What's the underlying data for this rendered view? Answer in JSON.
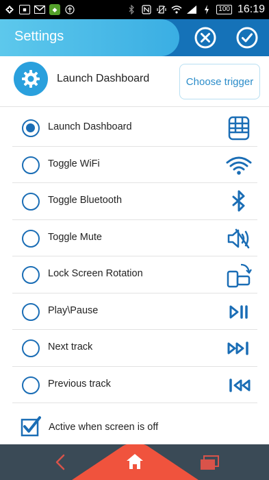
{
  "status_bar": {
    "time": "16:19",
    "battery": "100"
  },
  "header": {
    "title": "Settings"
  },
  "trigger": {
    "label": "Launch Dashboard",
    "button_label": "Choose trigger"
  },
  "options": [
    {
      "label": "Launch Dashboard",
      "checked": true,
      "icon": "dashboard-grid-icon"
    },
    {
      "label": "Toggle WiFi",
      "checked": false,
      "icon": "wifi-icon"
    },
    {
      "label": "Toggle Bluetooth",
      "checked": false,
      "icon": "bluetooth-icon"
    },
    {
      "label": "Toggle Mute",
      "checked": false,
      "icon": "mute-speaker-icon"
    },
    {
      "label": "Lock Screen Rotation",
      "checked": false,
      "icon": "screen-rotation-icon"
    },
    {
      "label": "Play\\Pause",
      "checked": false,
      "icon": "play-pause-icon"
    },
    {
      "label": "Next track",
      "checked": false,
      "icon": "next-track-icon"
    },
    {
      "label": "Previous track",
      "checked": false,
      "icon": "previous-track-icon"
    }
  ],
  "screen_off": {
    "label": "Active when screen is off",
    "checked": true
  },
  "colors": {
    "accent": "#1a6db5",
    "header": "#1572b8",
    "header_tab": "#3aaee3",
    "nav_bar": "#3a4a56",
    "home": "#f0533d"
  }
}
